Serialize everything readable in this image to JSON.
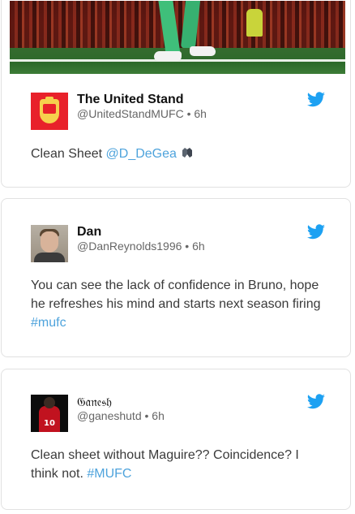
{
  "tweets": [
    {
      "author": "The United Stand",
      "handle": "@UnitedStandMUFC",
      "time": "6h",
      "text": "Clean Sheet ",
      "mention": "@D_DeGea",
      "hashtag": "",
      "avatar_icon": "united-stand-crest",
      "has_media": true
    },
    {
      "author": "Dan",
      "handle": "@DanReynolds1996",
      "time": "6h",
      "text": "You can see the lack of confidence in Bruno, hope he refreshes his mind and starts next season firing ",
      "mention": "",
      "hashtag": "#mufc",
      "avatar_icon": "user-photo",
      "has_media": false
    },
    {
      "author": "𝔊𝔞𝔫𝔢𝔰𝔥",
      "handle": "@ganeshutd",
      "time": "6h",
      "text": "Clean sheet without Maguire?? Coincidence? I think not. ",
      "mention": "",
      "hashtag": "#MUFC",
      "avatar_icon": "user-photo",
      "has_media": false
    }
  ],
  "separator": "•",
  "colors": {
    "link": "#4ea3dc",
    "twitter": "#1da1f2",
    "card_border": "#e1e1e1"
  },
  "icons": {
    "platform": "twitter-bird-icon",
    "emoji": "gloves-emoji"
  }
}
